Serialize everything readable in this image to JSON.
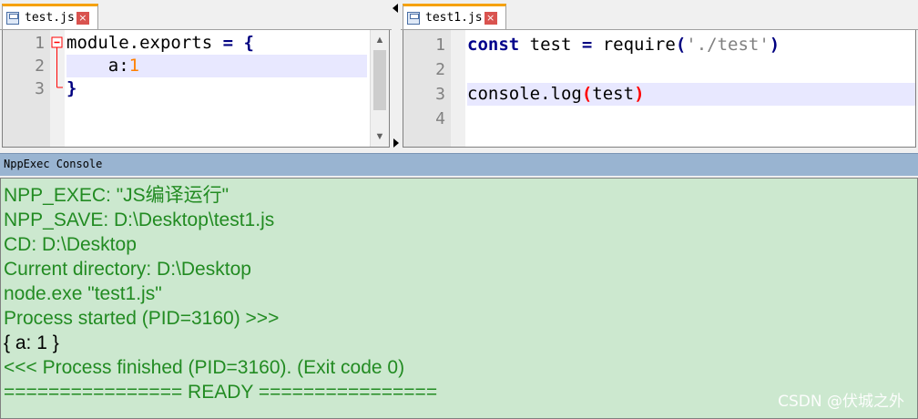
{
  "left_editor": {
    "tab_label": "test.js",
    "close_glyph": "×",
    "line_numbers": [
      "1",
      "2",
      "3"
    ],
    "code": {
      "l1_ident": "module.exports",
      "l1_op": " = {",
      "l2_ident": "    a:",
      "l2_num": "1",
      "l3_brace": "}"
    }
  },
  "right_editor": {
    "tab_label": "test1.js",
    "close_glyph": "×",
    "line_numbers": [
      "1",
      "2",
      "3",
      "4"
    ],
    "code": {
      "l1_kw": "const",
      "l1_ident": " test ",
      "l1_op": "=",
      "l1_call": " require",
      "l1_paren_open": "(",
      "l1_str": "'./test'",
      "l1_paren_close": ")",
      "l3_call": "console.log",
      "l3_paren_open": "(",
      "l3_arg": "test",
      "l3_paren_close": ")"
    }
  },
  "console": {
    "title": "NppExec Console",
    "lines": [
      "NPP_EXEC: \"JS编译运行\"",
      "NPP_SAVE: D:\\Desktop\\test1.js",
      "CD: D:\\Desktop",
      "Current directory: D:\\Desktop",
      "node.exe \"test1.js\"",
      "Process started (PID=3160) >>>",
      "{ a: 1 }",
      "<<< Process finished (PID=3160). (Exit code 0)",
      "================ READY ================"
    ],
    "watermark": "CSDN @伏城之外"
  },
  "colors": {
    "console_bg": "#cce8cf",
    "console_text": "#228b22",
    "tab_accent": "#f6a100",
    "keyword": "#00008b",
    "number": "#ff8000",
    "bracket_match": "#ff0000"
  },
  "icons": [
    "save-icon",
    "close-icon",
    "fold-minus-icon",
    "arrow-up-icon",
    "arrow-down-icon"
  ]
}
